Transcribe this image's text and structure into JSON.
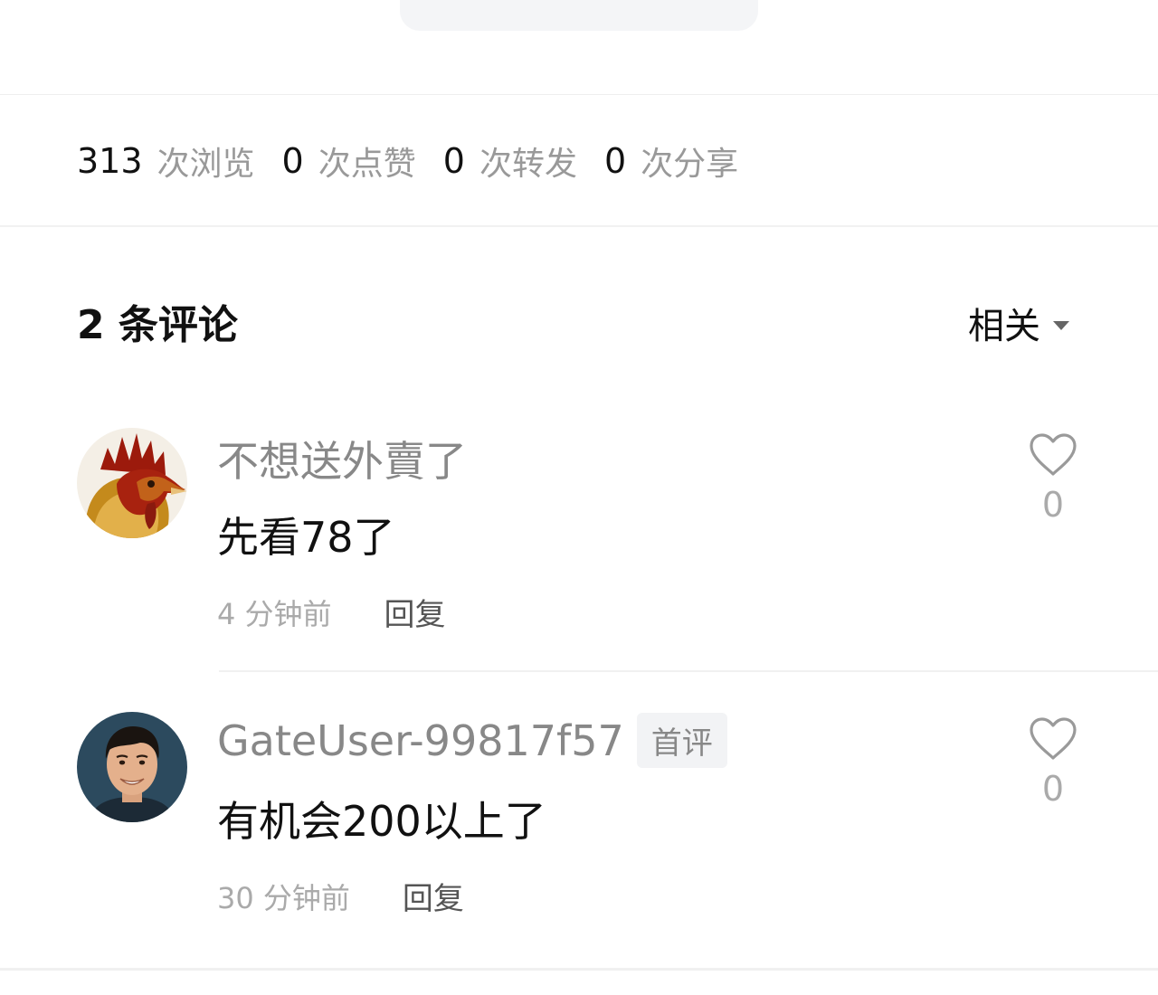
{
  "stats": [
    {
      "value": "313",
      "label": "次浏览"
    },
    {
      "value": "0",
      "label": "次点赞"
    },
    {
      "value": "0",
      "label": "次转发"
    },
    {
      "value": "0",
      "label": "次分享"
    }
  ],
  "comments_header": {
    "title": "2 条评论",
    "sort_label": "相关"
  },
  "comments": [
    {
      "author": "不想送外賣了",
      "text": "先看78了",
      "time": "4 分钟前",
      "reply_label": "回复",
      "likes": "0",
      "avatar_icon": "rooster-avatar-icon"
    },
    {
      "author": "GateUser-99817f57",
      "badge": "首评",
      "text": "有机会200以上了",
      "time": "30 分钟前",
      "reply_label": "回复",
      "likes": "0",
      "avatar_icon": "man-avatar-icon"
    }
  ],
  "colors": {
    "primary_text": "#111111",
    "secondary_text": "#999999",
    "muted_text": "#aaaaaa",
    "divider": "#f1f1f1"
  }
}
